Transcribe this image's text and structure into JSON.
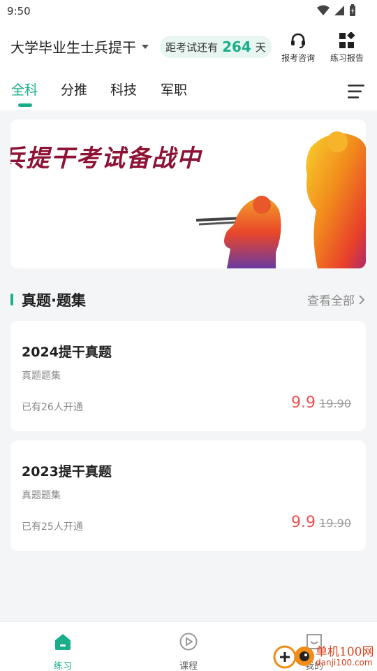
{
  "status": {
    "time": "9:50"
  },
  "header": {
    "exam_name": "大学毕业生士兵提干",
    "countdown_prefix": "距考试还有",
    "countdown_days": "264",
    "countdown_suffix": "天",
    "consult_label": "报考咨询",
    "report_label": "练习报告"
  },
  "tabs": [
    {
      "label": "全科",
      "active": true
    },
    {
      "label": "分推"
    },
    {
      "label": "科技"
    },
    {
      "label": "军职"
    }
  ],
  "banner": {
    "text": "兵提干考试备战中"
  },
  "section": {
    "title": "真题·题集",
    "view_all": "查看全部"
  },
  "cards": [
    {
      "title": "2024提干真题",
      "subtitle": "真题题集",
      "buyers": "已有26人开通",
      "price": "9.9",
      "original_price": "19.90"
    },
    {
      "title": "2023提干真题",
      "subtitle": "真题题集",
      "buyers": "已有25人开通",
      "price": "9.9",
      "original_price": "19.90"
    }
  ],
  "bottom_nav": [
    {
      "label": "练习",
      "icon": "home-icon",
      "active": true
    },
    {
      "label": "课程",
      "icon": "play-circle-icon"
    },
    {
      "label": "我的",
      "icon": "smile-icon"
    }
  ],
  "watermark": {
    "line1": "单机100网",
    "line2": "danji100.com"
  },
  "colors": {
    "accent": "#1aae8a",
    "price": "#ef5350",
    "countdown_bg": "#e8f6f1"
  }
}
